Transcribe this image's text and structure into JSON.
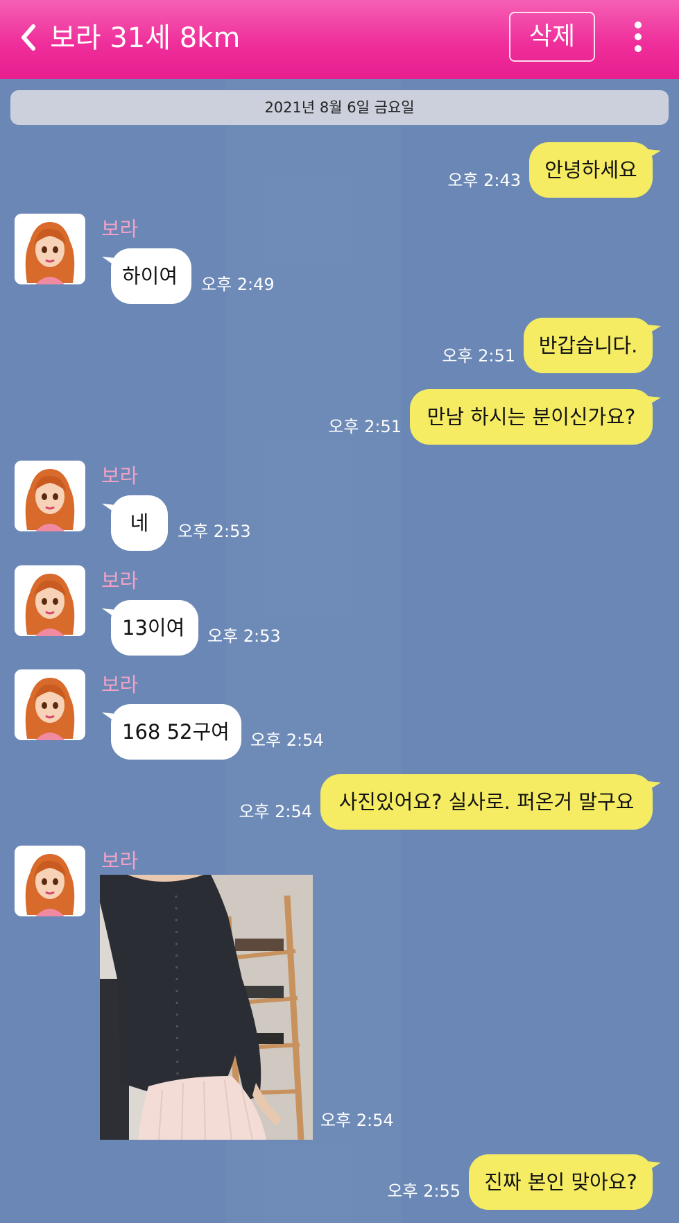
{
  "header": {
    "title": "보라 31세 8km",
    "delete_label": "삭제",
    "color": "#ef2f9b"
  },
  "date_separator": "2021년 8월 6일 금요일",
  "sender_name": "보라",
  "messages": [
    {
      "from": "me",
      "text": "안녕하세요",
      "time": "오후 2:43"
    },
    {
      "from": "them",
      "text": "하이여",
      "time": "오후 2:49"
    },
    {
      "from": "me",
      "text": "반갑습니다.",
      "time": "오후 2:51"
    },
    {
      "from": "me",
      "text": "만남 하시는 분이신가요?",
      "time": "오후 2:51"
    },
    {
      "from": "them",
      "text": "네",
      "time": "오후 2:53"
    },
    {
      "from": "them",
      "text": "13이여",
      "time": "오후 2:53"
    },
    {
      "from": "them",
      "text": "168 52구여",
      "time": "오후 2:54"
    },
    {
      "from": "me",
      "text": "사진있어요? 실사로. 퍼온거 말구요",
      "time": "오후 2:54"
    },
    {
      "from": "them",
      "type": "photo",
      "time": "오후 2:54"
    },
    {
      "from": "me",
      "text": "진짜 본인 맞아요?",
      "time": "오후 2:55"
    }
  ],
  "colors": {
    "background": "#6a87b5",
    "my_bubble": "#f5ec63",
    "their_bubble": "#ffffff",
    "sender_name": "#f2a2c6"
  },
  "icons": [
    "back-chevron-icon",
    "more-vertical-icon"
  ]
}
